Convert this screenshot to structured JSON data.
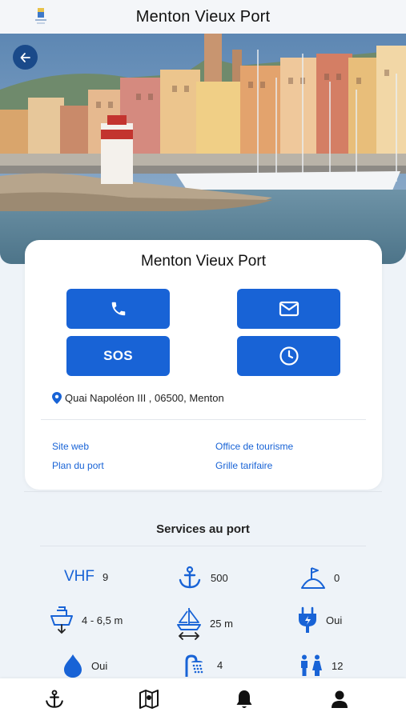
{
  "header": {
    "title": "Menton Vieux Port"
  },
  "port": {
    "name": "Menton Vieux Port",
    "sos_label": "SOS",
    "address": "Quai Napoléon III , 06500, Menton"
  },
  "links": {
    "site_web": "Site web",
    "office": "Office de tourisme",
    "plan": "Plan du port",
    "grille": "Grille tarifaire"
  },
  "services": {
    "title": "Services au port",
    "vhf_label": "VHF",
    "vhf": "9",
    "moorings": "500",
    "visitor_places": "0",
    "draft": "4 - 6,5 m",
    "max_length": "25 m",
    "electricity": "Oui",
    "fuel": "Oui",
    "showers": "4",
    "toilets": "12"
  },
  "icons": {
    "back": "back-arrow-icon",
    "phone": "phone-icon",
    "mail": "mail-icon",
    "clock": "clock-icon",
    "pin": "location-pin-icon",
    "anchor": "anchor-icon",
    "flag": "visitor-flag-icon",
    "draft": "boat-draft-icon",
    "length": "sailboat-length-icon",
    "plug": "electric-plug-icon",
    "drop": "fuel-drop-icon",
    "shower": "shower-icon",
    "wc": "toilets-icon",
    "tab_anchor": "anchor-icon",
    "tab_map": "map-icon",
    "tab_bell": "bell-icon",
    "tab_user": "user-icon"
  },
  "colors": {
    "accent": "#1863d6",
    "back_button": "#1a4a8a"
  }
}
